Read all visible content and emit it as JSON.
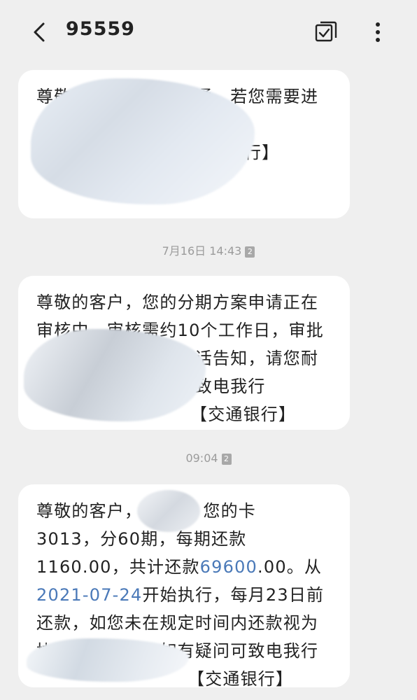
{
  "header": {
    "title": "95559",
    "back_icon": "back-chevron-icon",
    "check_icon": "multi-select-icon",
    "more_icon": "more-vertical-icon"
  },
  "messages": [
    {
      "text_visible": "尊敬的客户，如电话通，若您需要进一步款业务，可在我行",
      "tail_link": "38",
      "tail_text": "。【交通银行】"
    },
    {
      "timestamp": "7月16日 14:43",
      "sim": "2"
    },
    {
      "text": "尊敬的客户，您的分期方案申请正在审核中，审核需约10个工作日，审批结果将会以短信或电话告知，请您耐心等待。如有疑问可致电我行",
      "tail_text": "【交通银行】"
    },
    {
      "timestamp": "09:04",
      "sim": "2"
    },
    {
      "line1_prefix": "尊敬的客户，",
      "line1_suffix": "：您的卡",
      "line2": "3013，分60期，每期还款",
      "line3_a": "1160.00，共计还款",
      "line3_link": "69600",
      "line3_b": ".00。从",
      "line4_link": "2021-07-24",
      "line4_b": "开始执行，每月23日前",
      "line5": "还款，如您未在规定时间内还款视为",
      "line6": "协商协议失效，如有疑问可致电我行",
      "tail_text": "【交通银行】"
    }
  ],
  "colors": {
    "background": "#efefef",
    "bubble": "#ffffff",
    "link": "#4a79b8",
    "text": "#222222",
    "timestamp": "#9b9b9b"
  }
}
